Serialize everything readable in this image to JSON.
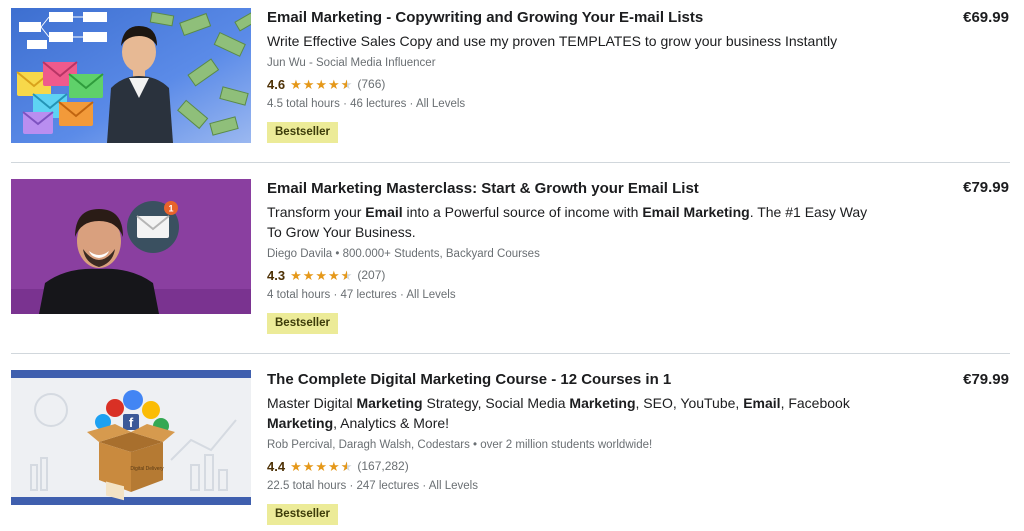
{
  "courses": [
    {
      "title": "Email Marketing - Copywriting and Growing Your E-mail Lists",
      "description_parts": [
        {
          "text": "Write Effective Sales Copy and use my proven TEMPLATES to grow your business Instantly",
          "bold": false
        }
      ],
      "instructor": "Jun Wu - Social Media Influencer",
      "rating": "4.6",
      "stars": 4.5,
      "rating_count": "(766)",
      "meta": "4.5 total hours · 46 lectures · All Levels",
      "badge": "Bestseller",
      "price": "€69.99"
    },
    {
      "title": "Email Marketing Masterclass: Start & Growth your Email List",
      "description_parts": [
        {
          "text": "Transform your ",
          "bold": false
        },
        {
          "text": "Email",
          "bold": true
        },
        {
          "text": " into a Powerful source of income with ",
          "bold": false
        },
        {
          "text": "Email Marketing",
          "bold": true
        },
        {
          "text": ". The #1 Easy Way To Grow Your Business.",
          "bold": false
        }
      ],
      "instructor": "Diego Davila • 800.000+ Students, Backyard Courses",
      "rating": "4.3",
      "stars": 4.5,
      "rating_count": "(207)",
      "meta": "4 total hours · 47 lectures · All Levels",
      "badge": "Bestseller",
      "price": "€79.99",
      "thumb_badge": "1"
    },
    {
      "title": "The Complete Digital Marketing Course - 12 Courses in 1",
      "description_parts": [
        {
          "text": "Master Digital ",
          "bold": false
        },
        {
          "text": "Marketing",
          "bold": true
        },
        {
          "text": " Strategy, Social Media ",
          "bold": false
        },
        {
          "text": "Marketing",
          "bold": true
        },
        {
          "text": ", SEO, YouTube, ",
          "bold": false
        },
        {
          "text": "Email",
          "bold": true
        },
        {
          "text": ", Facebook ",
          "bold": false
        },
        {
          "text": "Marketing",
          "bold": true
        },
        {
          "text": ", Analytics & More!",
          "bold": false
        }
      ],
      "instructor": "Rob Percival, Daragh Walsh, Codestars • over 2 million students worldwide!",
      "rating": "4.4",
      "stars": 4.5,
      "rating_count": "(167,282)",
      "meta": "22.5 total hours · 247 lectures · All Levels",
      "badge": "Bestseller",
      "price": "€79.99",
      "thumb_label": "Digital Delivery"
    }
  ],
  "colors": {
    "star": "#e59819",
    "badge_bg": "#eceb98",
    "rating_text": "#4d3105",
    "muted": "#6a6f73",
    "divider": "#d1d7dc"
  }
}
